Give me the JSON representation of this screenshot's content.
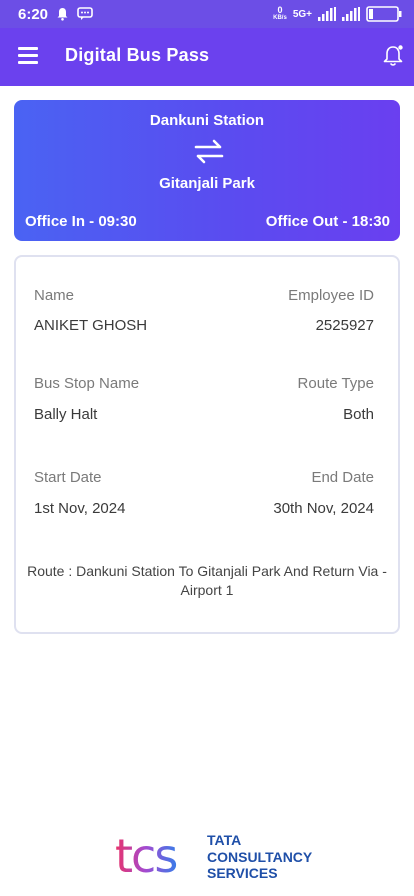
{
  "status": {
    "time": "6:20",
    "net_speed": "0",
    "net_unit": "KB/s",
    "network": "5G+"
  },
  "header": {
    "title": "Digital Bus Pass"
  },
  "route": {
    "from": "Dankuni Station",
    "to": "Gitanjali Park",
    "office_in": "Office In - 09:30",
    "office_out": "Office Out - 18:30"
  },
  "details": {
    "name_label": "Name",
    "name_value": "ANIKET GHOSH",
    "emp_label": "Employee ID",
    "emp_value": "2525927",
    "stop_label": "Bus Stop Name",
    "stop_value": "Bally Halt",
    "type_label": "Route Type",
    "type_value": "Both",
    "start_label": "Start Date",
    "start_value": "1st Nov, 2024",
    "end_label": "End Date",
    "end_value": "30th Nov, 2024",
    "route_text": "Route : Dankuni Station To Gitanjali Park And Return Via - Airport 1"
  },
  "logo": {
    "mark": "tcs",
    "line1": "TATA",
    "line2": "CONSULTANCY",
    "line3": "SERVICES"
  },
  "colors": {
    "primary": "#6b41ee",
    "card_start": "#4a63f3",
    "card_end": "#6a3ff0"
  }
}
